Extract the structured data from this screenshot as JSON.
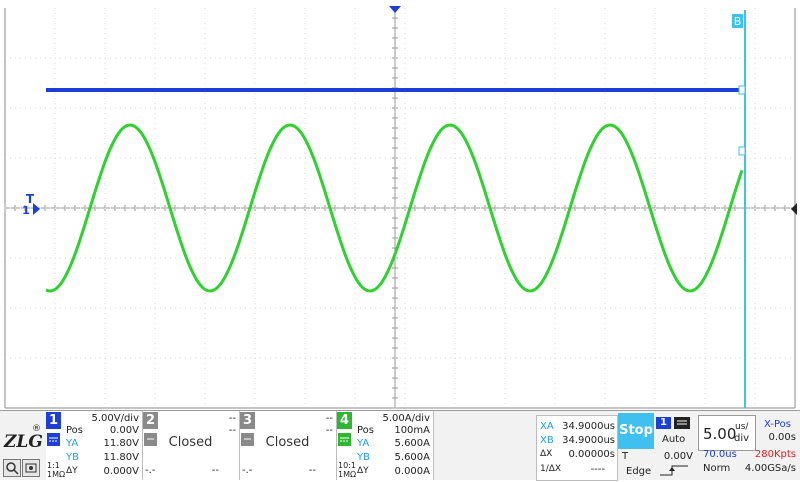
{
  "colors": {
    "ch1": "#1e3fd6",
    "ch4": "#2fd02f",
    "cursor": "#3fc0ee",
    "stop": "#3fc0ee",
    "red": "#e02020"
  },
  "scope": {
    "markers": {
      "cursor_b": "B",
      "trigger": "T",
      "ch_label": "1"
    }
  },
  "ch1": {
    "num": "1",
    "scale": "5.00V/div",
    "pos_label": "Pos",
    "pos_value": "0.00V",
    "ya_label": "YA",
    "ya_value": "11.80V",
    "yb_label": "YB",
    "yb_value": "11.80V",
    "dy_label": "ΔY",
    "dy_value": "0.000V",
    "coupling": "1:1",
    "impedance": "1MΩ"
  },
  "ch2": {
    "num": "2",
    "top": "--",
    "mid": "--",
    "closed": "Closed",
    "foot_left": "-.-",
    "foot_right": "--"
  },
  "ch3": {
    "num": "3",
    "top": "--",
    "mid": "--",
    "closed": "Closed",
    "foot_left": "-.-",
    "foot_right": "--"
  },
  "ch4": {
    "num": "4",
    "scale": "5.00A/div",
    "pos_label": "Pos",
    "pos_value": "100mA",
    "ya_label": "YA",
    "ya_value": "5.600A",
    "yb_label": "YB",
    "yb_value": "5.600A",
    "dy_label": "ΔY",
    "dy_value": "0.000A",
    "coupling": "10:1",
    "impedance": "1MΩ"
  },
  "cursors": {
    "xa_label": "XA",
    "xa_value": "34.9000us",
    "xb_label": "XB",
    "xb_value": "34.9000us",
    "dx_label": "ΔX",
    "dx_value": "0.00000s",
    "inv_label": "1/ΔX",
    "inv_value": "----"
  },
  "run": {
    "state": "Stop"
  },
  "trigger": {
    "source": "1",
    "mode": "Auto",
    "t_label": "T",
    "level": "0.00V",
    "type": "Edge"
  },
  "timebase": {
    "scale": "5.00",
    "unit_top": "us/",
    "unit_bottom": "div",
    "xpos_label": "X-Pos",
    "xpos_value": "0.00s",
    "delay": "70.0us",
    "points": "280Kpts",
    "acq_mode": "Norm",
    "sample_rate": "4.00GSa/s"
  }
}
